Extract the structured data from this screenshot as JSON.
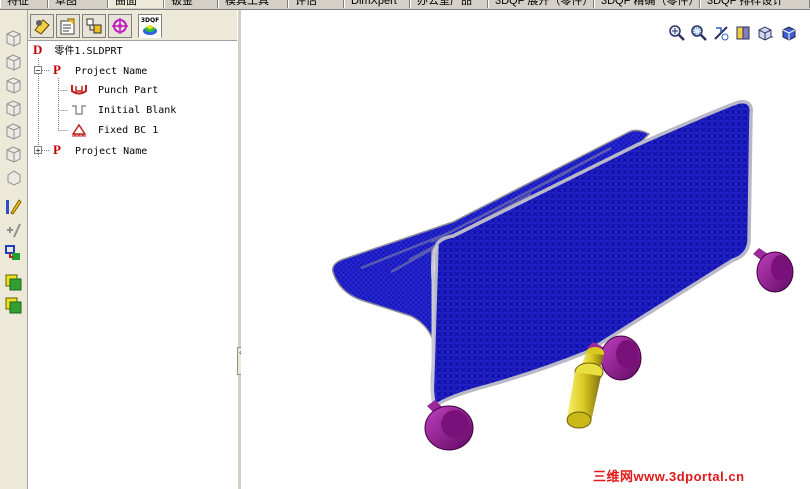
{
  "tabs": [
    {
      "label": "特征"
    },
    {
      "label": "草图"
    },
    {
      "label": "曲面",
      "active": true
    },
    {
      "label": "钣金"
    },
    {
      "label": "模具工具"
    },
    {
      "label": "评估"
    },
    {
      "label": "DimXpert"
    },
    {
      "label": "办公室产品"
    },
    {
      "label": "3DQF 展开（零件）"
    },
    {
      "label": "3DQF 精确（零件）"
    },
    {
      "label": "3DQF 排样设计"
    }
  ],
  "panel": {
    "tabs": [
      {
        "icon": "feature-manager-icon"
      },
      {
        "icon": "property-manager-icon"
      },
      {
        "icon": "configuration-manager-icon"
      },
      {
        "icon": "dimxpert-manager-icon"
      },
      {
        "icon": "3dqf-icon",
        "label": "3DQF",
        "active": true
      }
    ]
  },
  "tree": {
    "root": {
      "letter": "D",
      "label": "零件1.SLDPRT"
    },
    "project1": {
      "letter": "P",
      "label": "Project Name",
      "expander": "−"
    },
    "children": [
      {
        "icon": "punch-part-icon",
        "label": "Punch Part"
      },
      {
        "icon": "initial-blank-icon",
        "label": "Initial Blank"
      },
      {
        "icon": "fixed-bc-icon",
        "label": "Fixed BC 1"
      }
    ],
    "project2": {
      "letter": "P",
      "label": "Project Name",
      "expander": "+"
    }
  },
  "view_tools": [
    "zoom-to-fit-icon",
    "zoom-to-area-icon",
    "previous-view-icon",
    "section-view-icon",
    "view-orientation-icon",
    "display-style-icon"
  ],
  "splitter_grip": "‹‹",
  "watermark": "三维网www.3dportal.cn",
  "colors": {
    "sheet": "#1a1acc",
    "sheet_edge": "#b8b8c8",
    "support": "#8a1a8a",
    "punch_pin": "#d8d020"
  }
}
